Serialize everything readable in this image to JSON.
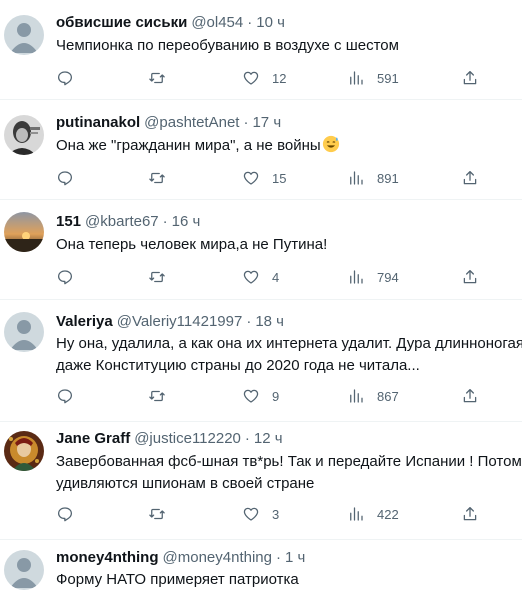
{
  "tweets": [
    {
      "name": "обвисшие сиськи",
      "handle": "@ol454",
      "time": "10 ч",
      "text_lines": [
        "Чемпионка по переобуванию в воздухе с шестом"
      ],
      "likes": "12",
      "views": "591",
      "avatar": "default-avatar"
    },
    {
      "name": "putinanakol",
      "handle": "@pashtetAnet",
      "time": "17 ч",
      "text_lines": [
        "Она же \"гражданин мира\", а не войны"
      ],
      "emoji": "sweat-smile-emoji",
      "likes": "15",
      "views": "891",
      "avatar": "portrait-avatar"
    },
    {
      "name": "151",
      "handle": "@kbarte67",
      "time": "16 ч",
      "text_lines": [
        "Она теперь человек мира,а не Путина!"
      ],
      "likes": "4",
      "views": "794",
      "avatar": "sunset-avatar"
    },
    {
      "name": "Valeriya",
      "handle": "@Valeriy11421997",
      "time": "18 ч",
      "text_lines": [
        "Ну она, удалила, а как она их интернета удалит. Дура длинноногая, с",
        "даже Конституцию страны до 2020 года не читала..."
      ],
      "likes": "9",
      "views": "867",
      "avatar": "default-avatar"
    },
    {
      "name": "Jane Graff",
      "handle": "@justice112220",
      "time": "12 ч",
      "text_lines": [
        "Завербованная фсб-шная тв*рь! Так и передайте Испании ! Потом",
        "удивляются шпионам в своей стране"
      ],
      "likes": "3",
      "views": "422",
      "avatar": "painting-avatar"
    },
    {
      "name": "money4nthing",
      "handle": "@money4nthing",
      "time": "1 ч",
      "text_lines": [
        "Форму НАТО примеряет патриотка"
      ],
      "avatar": "default-avatar"
    }
  ],
  "separator": "·",
  "colors": {
    "text": "#0f1419",
    "secondary": "#536471",
    "border": "#eff3f4"
  }
}
